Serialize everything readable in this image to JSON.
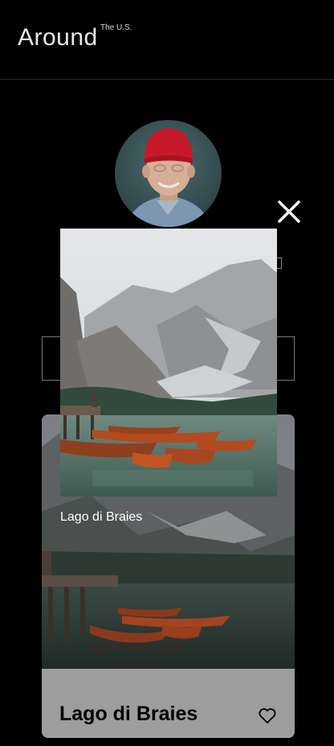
{
  "header": {
    "logo_text": "Around",
    "logo_superscript": "The U.S."
  },
  "popup": {
    "caption": "Lago di Braies"
  },
  "card": {
    "title": "Lago di Braies"
  },
  "icons": {
    "close": "close-icon",
    "like": "heart-icon"
  },
  "colors": {
    "page_background": "#000000",
    "card_footer": "#9d9d9d",
    "avatar_hat": "#c8192a"
  }
}
